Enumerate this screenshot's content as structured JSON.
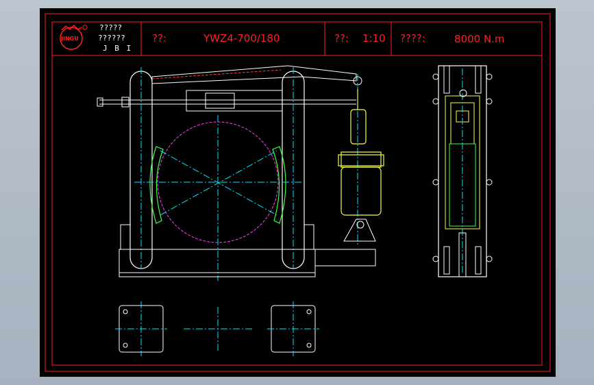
{
  "title_block": {
    "company_line1": "?????",
    "company_line2": "??????",
    "company_line3": "J B I",
    "logo_text": "JINGU",
    "model_label": "??:",
    "model_value": "YWZ4-700/180",
    "scale_label": "??:",
    "scale_value": "1:10",
    "torque_label": "????:",
    "torque_value": "8000 N.m"
  },
  "colors": {
    "background": "#000000",
    "frame": "#ff2020",
    "geometry": "#ffffff",
    "centerline": "#00e5ff",
    "drum_circle": "#ff40ff",
    "brake_shoe": "#40ff40",
    "thruster": "#ffff40"
  },
  "icons": {
    "logo": "company-logo-icon"
  }
}
